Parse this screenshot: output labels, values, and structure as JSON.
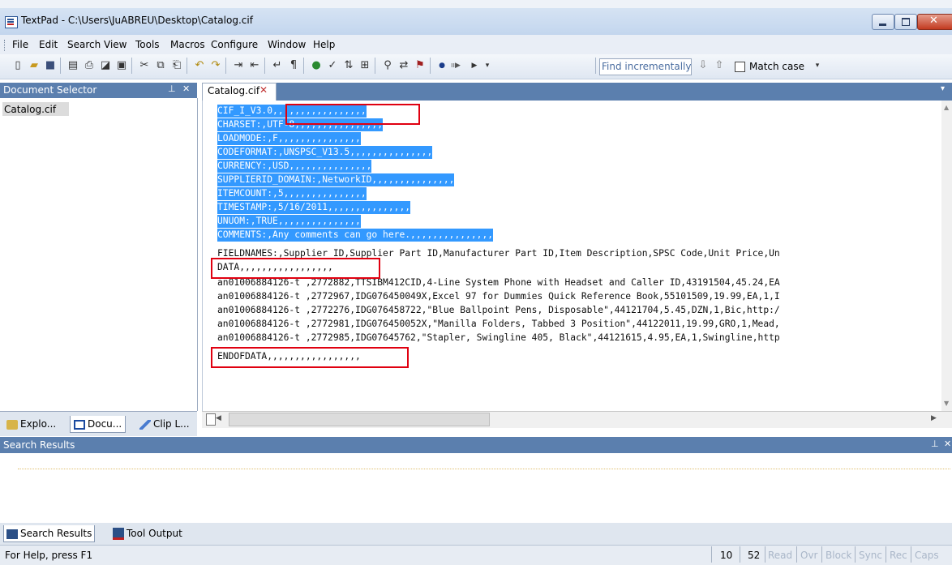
{
  "window": {
    "title": "TextPad - C:\\Users\\JuABREU\\Desktop\\Catalog.cif"
  },
  "menu": [
    "File",
    "Edit",
    "Search",
    "View",
    "Tools",
    "Macros",
    "Configure",
    "Window",
    "Help"
  ],
  "toolbar": {
    "find_placeholder": "Find incrementally",
    "match_case_label": "Match case"
  },
  "document_selector": {
    "title": "Document Selector",
    "items": [
      "Catalog.cif"
    ],
    "tabs": [
      "Explo...",
      "Docu...",
      "Clip L..."
    ]
  },
  "editor": {
    "tab_label": "Catalog.cif",
    "lines": [
      "CIF_I_V3.0,,,,,,,,,,,,,,,,,",
      "CHARSET:,UTF-8,,,,,,,,,,,,,,,,",
      "LOADMODE:,F,,,,,,,,,,,,,,,",
      "CODEFORMAT:,UNSPSC_V13.5,,,,,,,,,,,,,,,",
      "CURRENCY:,USD,,,,,,,,,,,,,,,",
      "SUPPLIERID_DOMAIN:,NetworkID,,,,,,,,,,,,,,,",
      "ITEMCOUNT:,5,,,,,,,,,,,,,,,",
      "TIMESTAMP:,5/16/2011,,,,,,,,,,,,,,,",
      "UNUOM:,TRUE,,,,,,,,,,,,,,,",
      "COMMENTS:,Any comments can go here.,,,,,,,,,,,,,,,",
      "FIELDNAMES:,Supplier ID,Supplier Part ID,Manufacturer Part ID,Item Description,SPSC Code,Unit Price,Un",
      "DATA,,,,,,,,,,,,,,,,,",
      "an01006884126-t ,2772882,TTSIBM412CID,4-Line System Phone with Headset and Caller ID,43191504,45.24,EA",
      "an01006884126-t ,2772967,IDG076450049X,Excel 97 for Dummies Quick Reference Book,55101509,19.99,EA,1,I",
      "an01006884126-t ,2772276,IDG076458722,\"Blue Ballpoint Pens, Disposable\",44121704,5.45,DZN,1,Bic,http:/",
      "an01006884126-t ,2772981,IDG076450052X,\"Manilla Folders, Tabbed 3 Position\",44122011,19.99,GRO,1,Mead,",
      "an01006884126-t ,2772985,IDG07645762,\"Stapler, Swingline 405, Black\",44121615,4.95,EA,1,Swingline,http",
      "ENDOFDATA,,,,,,,,,,,,,,,,,"
    ]
  },
  "search_results": {
    "title": "Search Results",
    "tabs": [
      "Search Results",
      "Tool Output"
    ]
  },
  "status": {
    "help_text": "For Help, press F1",
    "line": "10",
    "col": "52",
    "indicators": [
      "Read",
      "Ovr",
      "Block",
      "Sync",
      "Rec",
      "Caps"
    ]
  },
  "colors": {
    "selection": "#3399ff",
    "highlight_box": "#e00010",
    "panel_header": "#5b7fae"
  }
}
